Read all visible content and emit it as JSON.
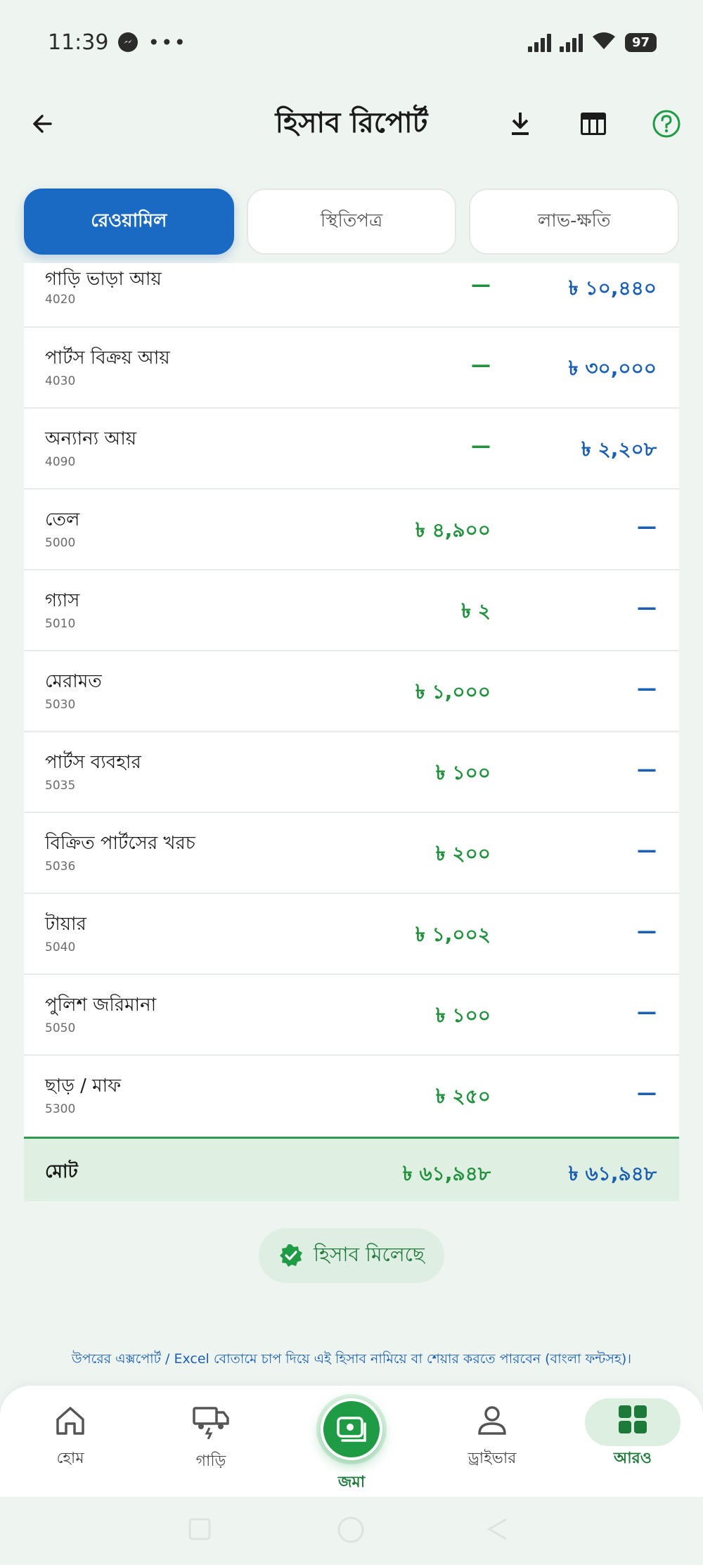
{
  "status_bar": {
    "time": "11:39",
    "dots": "•••",
    "battery": "97"
  },
  "header": {
    "title": "হিসাব রিপোর্ট"
  },
  "tabs": [
    {
      "label": "রেওয়ামিল",
      "active": true
    },
    {
      "label": "স্থিতিপত্র",
      "active": false
    },
    {
      "label": "লাভ-ক্ষতি",
      "active": false
    }
  ],
  "rows": [
    {
      "name": "গাড়ি ভাড়া আয়",
      "code": "4020",
      "debit": "—",
      "credit": "৳ ১০,৪৪০"
    },
    {
      "name": "পার্টস বিক্রয় আয়",
      "code": "4030",
      "debit": "—",
      "credit": "৳ ৩০,০০০"
    },
    {
      "name": "অন্যান্য আয়",
      "code": "4090",
      "debit": "—",
      "credit": "৳ ২,২০৮"
    },
    {
      "name": "তেল",
      "code": "5000",
      "debit": "৳ ৪,৯০০",
      "credit": "—"
    },
    {
      "name": "গ্যাস",
      "code": "5010",
      "debit": "৳ ২",
      "credit": "—"
    },
    {
      "name": "মেরামত",
      "code": "5030",
      "debit": "৳ ১,০০০",
      "credit": "—"
    },
    {
      "name": "পার্টস ব্যবহার",
      "code": "5035",
      "debit": "৳ ১০০",
      "credit": "—"
    },
    {
      "name": "বিক্রিত পার্টসের খরচ",
      "code": "5036",
      "debit": "৳ ২০০",
      "credit": "—"
    },
    {
      "name": "টায়ার",
      "code": "5040",
      "debit": "৳ ১,০০২",
      "credit": "—"
    },
    {
      "name": "পুলিশ জরিমানা",
      "code": "5050",
      "debit": "৳ ১০০",
      "credit": "—"
    },
    {
      "name": "ছাড় / মাফ",
      "code": "5300",
      "debit": "৳ ২৫০",
      "credit": "—"
    }
  ],
  "total": {
    "label": "মোট",
    "debit": "৳ ৬১,৯৪৮",
    "credit": "৳ ৬১,৯৪৮"
  },
  "balanced_label": "হিসাব মিলেছে",
  "note": "উপরের এক্সপোর্ট / Excel বোতামে চাপ দিয়ে এই হিসাব নামিয়ে বা শেয়ার করতে পারবেন (বাংলা ফন্টসহ)।",
  "nav": {
    "home": "হোম",
    "vehicle": "গাড়ি",
    "deposit": "জমা",
    "driver": "ড্রাইভার",
    "more": "আরও"
  },
  "colors": {
    "primary_blue": "#1a6ac3",
    "debit_green": "#22913e",
    "credit_blue": "#1a5fb4",
    "accent_green": "#1f9a45"
  }
}
